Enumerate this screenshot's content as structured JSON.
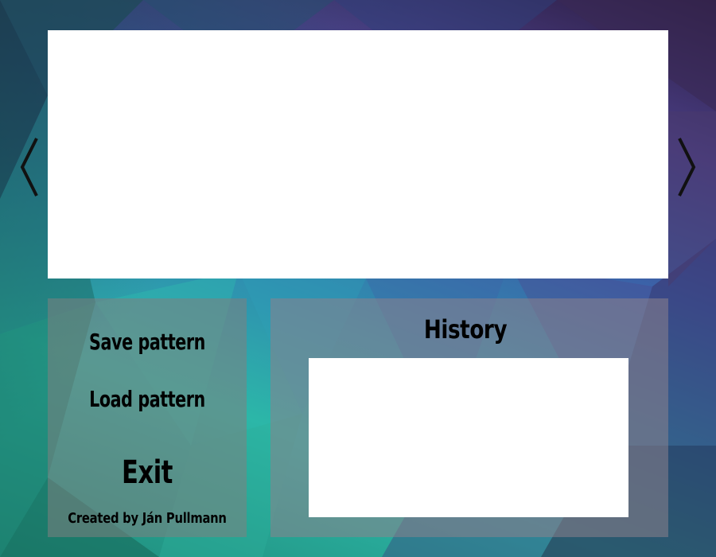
{
  "navigation": {
    "prev_icon": "chevron-left-icon",
    "next_icon": "chevron-right-icon"
  },
  "menu": {
    "save_label": "Save pattern",
    "load_label": "Load pattern",
    "exit_label": "Exit",
    "credit": "Created by Ján Pullmann"
  },
  "history": {
    "title": "History",
    "entries": []
  },
  "colors": {
    "panel_bg": "#808080",
    "canvas_bg": "#ffffff",
    "text": "#000000"
  }
}
